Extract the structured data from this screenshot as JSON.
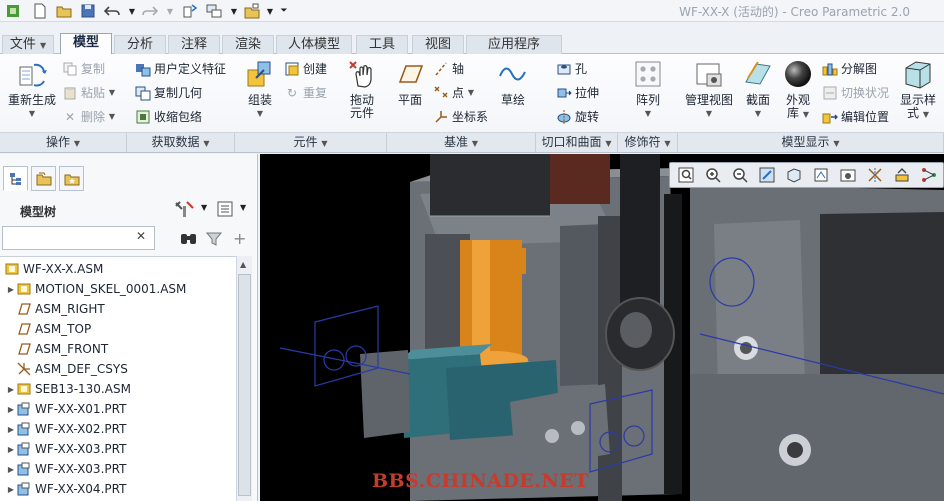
{
  "window": {
    "title": "WF-XX-X (活动的) - Creo Parametric 2.0",
    "quick_access": [
      "new-icon",
      "open-icon",
      "save-icon",
      "undo-icon",
      "redo-icon",
      "regenerate-icon",
      "switch-window-icon",
      "close-window-icon",
      "customize-icon"
    ]
  },
  "tabs": [
    "文件",
    "模型",
    "分析",
    "注释",
    "渲染",
    "人体模型",
    "工具",
    "视图",
    "应用程序"
  ],
  "active_tab": "模型",
  "ribbon": {
    "operations": {
      "regenerate": "重新生成",
      "copy": "复制",
      "paste": "粘贴",
      "delete": "删除",
      "group": "操作"
    },
    "get_data": {
      "udf": "用户定义特征",
      "copy_geom": "复制几何",
      "shrinkwrap": "收缩包络",
      "group": "获取数据"
    },
    "component": {
      "assemble": "组装",
      "create": "创建",
      "repeat": "重复",
      "group": "元件"
    },
    "drag": {
      "label_line1": "拖动",
      "label_line2": "元件"
    },
    "datum": {
      "plane": "平面",
      "axis": "轴",
      "point": "点",
      "csys": "坐标系",
      "sketch": "草绘",
      "group": "基准"
    },
    "cut_surface": {
      "hole": "孔",
      "extrude": "拉伸",
      "revolve": "旋转",
      "group": "切口和曲面"
    },
    "modifiers": {
      "pattern": "阵列",
      "group": "修饰符"
    },
    "model_display": {
      "manage_views": "管理视图",
      "section": "截面",
      "appearance_line1": "外观",
      "appearance_line2": "库",
      "exploded": "分解图",
      "toggle_status": "切换状况",
      "edit_position": "编辑位置",
      "display_style_line1": "显示样",
      "display_style_line2": "式",
      "group": "模型显示"
    }
  },
  "panel": {
    "title": "模型树",
    "search_value": "",
    "tree": [
      {
        "label": "WF-XX-X.ASM",
        "type": "asm",
        "expandable": false
      },
      {
        "label": "MOTION_SKEL_0001.ASM",
        "type": "asm",
        "expandable": true
      },
      {
        "label": "ASM_RIGHT",
        "type": "plane",
        "expandable": false
      },
      {
        "label": "ASM_TOP",
        "type": "plane",
        "expandable": false
      },
      {
        "label": "ASM_FRONT",
        "type": "plane",
        "expandable": false
      },
      {
        "label": "ASM_DEF_CSYS",
        "type": "csys",
        "expandable": false
      },
      {
        "label": "SEB13-130.ASM",
        "type": "asm",
        "expandable": true
      },
      {
        "label": "WF-XX-X01.PRT",
        "type": "prt",
        "expandable": true
      },
      {
        "label": "WF-XX-X02.PRT",
        "type": "prt",
        "expandable": true
      },
      {
        "label": "WF-XX-X03.PRT",
        "type": "prt",
        "expandable": true
      },
      {
        "label": "WF-XX-X03.PRT",
        "type": "prt",
        "expandable": true
      },
      {
        "label": "WF-XX-X04.PRT",
        "type": "prt",
        "expandable": true
      }
    ]
  },
  "viewport": {
    "toolbar_icons": [
      "refit-icon",
      "zoom-in-icon",
      "zoom-out-icon",
      "repaint-icon",
      "display-style-icon",
      "saved-views-icon",
      "view-manager-icon",
      "datum-display-icon",
      "spin-center-icon",
      "annotation-display-icon"
    ],
    "watermark": "BBS.CHINADE.NET"
  },
  "colors": {
    "accent": "#1b5fb4",
    "background": "#000000",
    "part_gray": "#5d6168",
    "part_teal": "#2f6f7a",
    "part_orange": "#e0901c"
  }
}
